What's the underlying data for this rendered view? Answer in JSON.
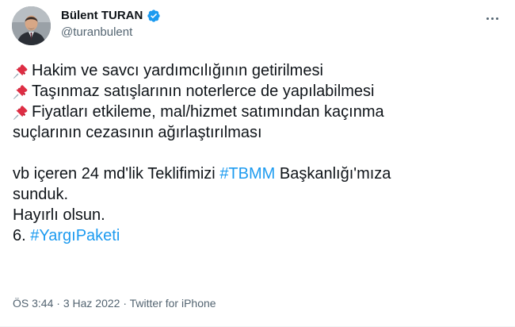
{
  "author": {
    "display_name": "Bülent TURAN",
    "handle": "@turanbulent",
    "verified_icon": "verified-badge-icon",
    "avatar_icon": "profile-photo"
  },
  "tweet": {
    "pin_icon": "pushpin-emoji",
    "bullets": [
      "Hakim ve savcı yardımcılığının getirilmesi",
      "Taşınmaz satışlarının noterlerce de yapılabilmesi",
      "Fiyatları etkileme, mal/hizmet satımından kaçınma"
    ],
    "bullet_continuation": "suçlarının cezasının ağırlaştırılması",
    "para_prefix": "vb içeren 24 md'lik Teklifimizi ",
    "hashtag_1": "#TBMM",
    "para_suffix": " Başkanlığı'mıza",
    "para_line2": "sunduk.",
    "closing": "Hayırlı olsun.",
    "final_prefix": "6. ",
    "hashtag_2": "#YargıPaketi"
  },
  "meta": {
    "time": "ÖS 3:44",
    "separator_1": " · ",
    "date": "3 Haz 2022",
    "separator_2": " · ",
    "source": "Twitter for iPhone"
  },
  "colors": {
    "text": "#0f1419",
    "secondary": "#536471",
    "link": "#1d9bf0",
    "pin": "#dd2e44"
  }
}
